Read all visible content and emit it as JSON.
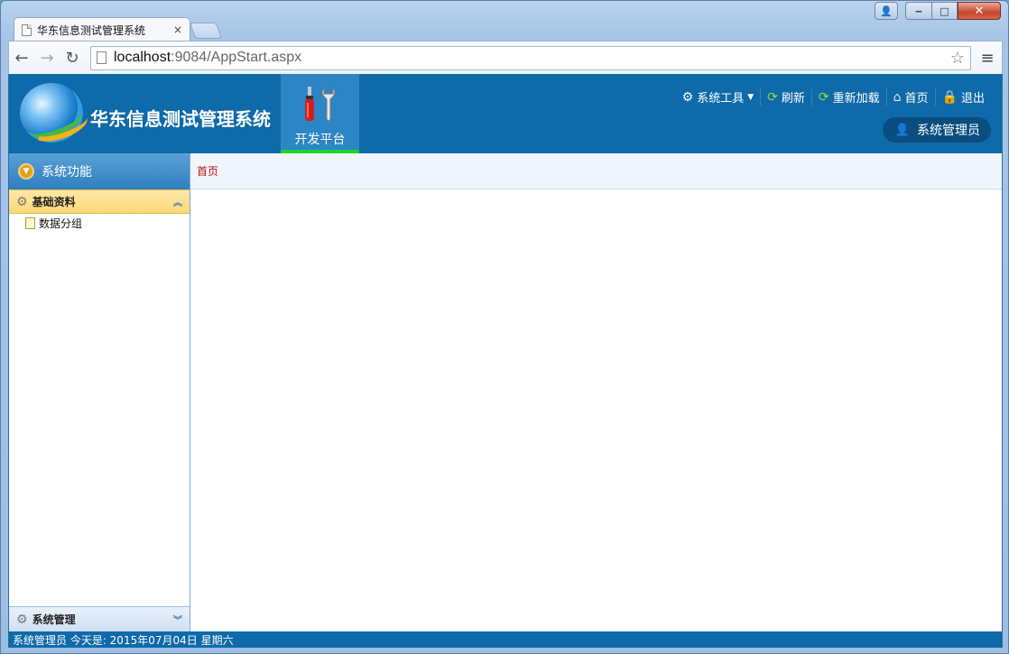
{
  "browser": {
    "tab_title": "华东信息测试管理系统",
    "tab_close": "×",
    "url_host": "localhost",
    "url_rest": ":9084/AppStart.aspx",
    "back": "←",
    "forward": "→",
    "reload": "↻",
    "star": "☆",
    "menu": "≡",
    "min": "‒",
    "max": "□",
    "close": "✕",
    "user_btn": "👤"
  },
  "app": {
    "title": "华东信息测试管理系统",
    "platform_tab": "开发平台",
    "links": [
      {
        "label": "系统工具",
        "icon": "gear-icon"
      },
      {
        "label": "刷新",
        "icon": "refresh-icon"
      },
      {
        "label": "重新加载",
        "icon": "reload-icon"
      },
      {
        "label": "首页",
        "icon": "home-icon"
      },
      {
        "label": "退出",
        "icon": "exit-icon"
      }
    ],
    "user": "系统管理员"
  },
  "sidebar": {
    "header": "系统功能",
    "section1": "基础资料",
    "items": [
      {
        "label": "数据分组"
      }
    ],
    "section2": "系统管理"
  },
  "content": {
    "tab": "首页"
  },
  "status": {
    "text": "系统管理员 今天是: 2015年07月04日 星期六"
  },
  "colors": {
    "header_bg": "#0e6aa8",
    "platform_tab_bg": "#2c85c4",
    "platform_underline": "#1bd42e",
    "content_tab_text": "#c01010"
  }
}
